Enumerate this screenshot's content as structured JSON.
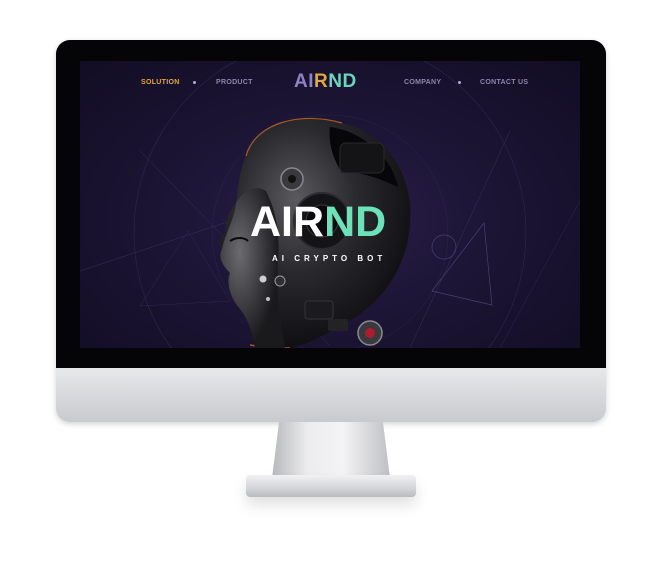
{
  "nav": {
    "left_items": [
      {
        "label": "SOLUTION",
        "active": true
      },
      {
        "label": "PRODUCT",
        "active": false
      }
    ],
    "right_items": [
      {
        "label": "COMPANY",
        "active": false
      },
      {
        "label": "CONTACT US",
        "active": false
      }
    ],
    "logo": {
      "part1": "AI",
      "part2": "R",
      "part3": "ND"
    }
  },
  "hero": {
    "title_white": "AIR",
    "title_green": "ND",
    "subtitle": "AI CRYPTO BOT"
  },
  "colors": {
    "background": "#1c1535",
    "accent_orange": "#e4a93b",
    "accent_green": "#6be2b7",
    "logo_purple": "#8d84c4",
    "nav_text": "#8f86ad"
  },
  "icons": [
    "robot-head-illustration",
    "nav-separator-dot"
  ]
}
